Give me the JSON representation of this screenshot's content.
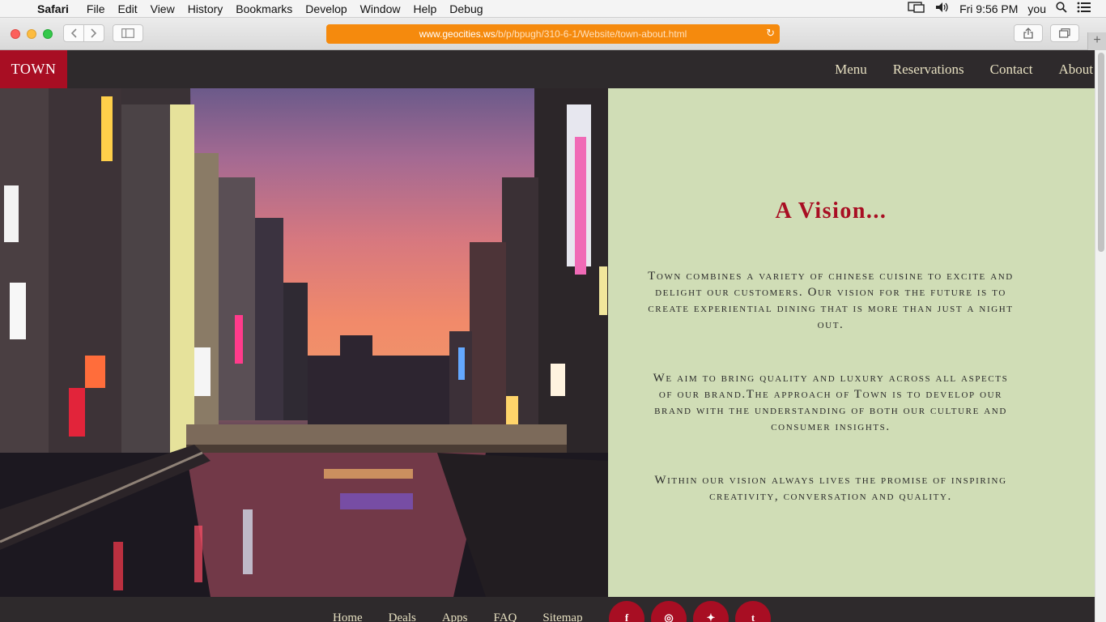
{
  "menubar": {
    "app": "Safari",
    "items": [
      "File",
      "Edit",
      "View",
      "History",
      "Bookmarks",
      "Develop",
      "Window",
      "Help",
      "Debug"
    ],
    "clock": "Fri 9:56 PM",
    "user": "you"
  },
  "browser": {
    "url_host": "www.geocities.ws",
    "url_path": "/b/p/bpugh/310-6-1/Website/town-about.html"
  },
  "site": {
    "logo": "TOWN",
    "nav": [
      "Menu",
      "Reservations",
      "Contact",
      "About"
    ],
    "heading": "A Vision...",
    "paragraphs": [
      "Town combines a variety of chinese cuisine to excite and delight our customers. Our vision for the future is to create experiential dining that is more than just a night out.",
      "We aim to bring quality and luxury across all aspects of our brand.The approach of Town is to develop our brand with the understanding of both our culture and consumer insights.",
      "Within our vision always lives the promise of inspiring creativity, conversation and quality."
    ],
    "footer_links": [
      "Home",
      "Deals",
      "Apps",
      "FAQ",
      "Sitemap"
    ],
    "social": [
      {
        "icon": "facebook-icon",
        "glyph": "f"
      },
      {
        "icon": "instagram-icon",
        "glyph": "◎"
      },
      {
        "icon": "twitter-icon",
        "glyph": "✦"
      },
      {
        "icon": "tumblr-icon",
        "glyph": "t"
      }
    ]
  },
  "colors": {
    "brand_red": "#a80e23",
    "nav_bg": "#2e2a2c",
    "panel_green": "#d0ddb6",
    "nav_text": "#e7e0c1",
    "url_orange": "#f58a0d"
  }
}
